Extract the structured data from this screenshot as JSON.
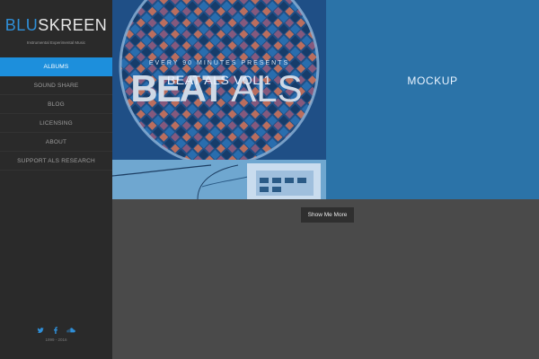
{
  "sidebar": {
    "logo_blu": "BLU",
    "logo_skreen": "SKREEN",
    "tagline": "Instrumental Experimental Music",
    "nav": [
      {
        "label": "ALBUMS",
        "active": true
      },
      {
        "label": "SOUND SHARE"
      },
      {
        "label": "BLOG"
      },
      {
        "label": "LICENSING"
      },
      {
        "label": "ABOUT"
      },
      {
        "label": "SUPPORT ALS RESEARCH"
      }
    ],
    "social": {
      "twitter_icon": "twitter-icon",
      "facebook_icon": "facebook-icon",
      "soundcloud_icon": "soundcloud-icon"
    },
    "copyright": "1999 - 2016"
  },
  "tiles": {
    "beat": {
      "art_top": "EVERY 90 MINUTES PRESENTS",
      "art_big": "BEAT",
      "art_big_right": "ALS",
      "title": "BEAT ALS VOL 1"
    },
    "mockup": {
      "title": "MOCKUP"
    }
  },
  "actions": {
    "show_more": "Show Me More"
  },
  "colors": {
    "accent": "#1d8fdc",
    "sidebar_bg": "#2a2a2a",
    "content_bg": "#4a4a4a",
    "mockup_bg": "#2b73a8"
  }
}
